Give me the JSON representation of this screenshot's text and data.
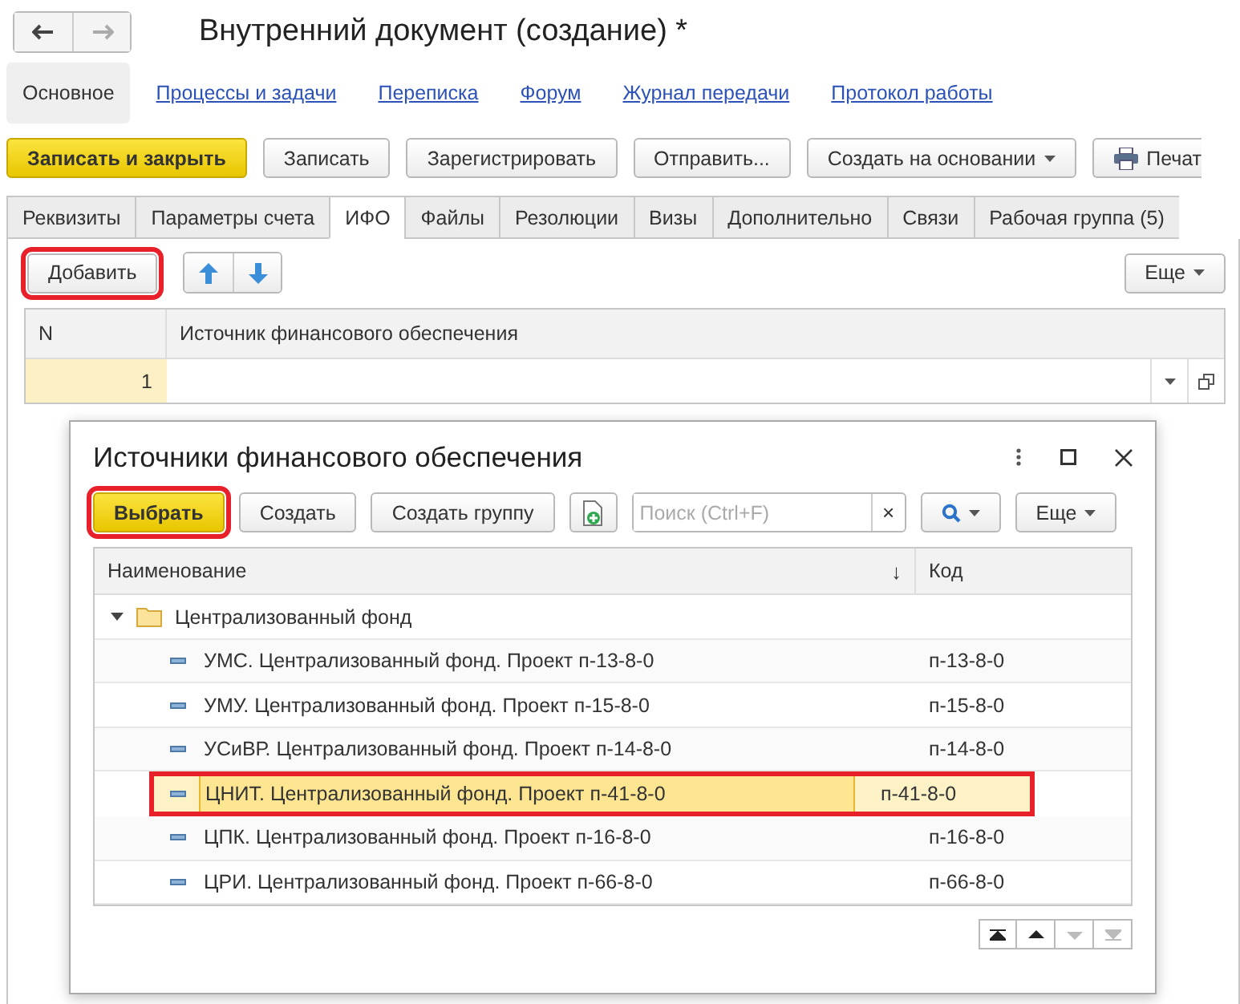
{
  "window": {
    "title": "Внутренний документ (создание) *"
  },
  "sections": [
    {
      "label": "Основное",
      "selected": true
    },
    {
      "label": "Процессы и задачи",
      "selected": false
    },
    {
      "label": "Переписка",
      "selected": false
    },
    {
      "label": "Форум",
      "selected": false
    },
    {
      "label": "Журнал передачи",
      "selected": false
    },
    {
      "label": "Протокол работы",
      "selected": false
    }
  ],
  "toolbar": [
    {
      "label": "Записать и закрыть",
      "kind": "primary"
    },
    {
      "label": "Записать",
      "kind": "plain"
    },
    {
      "label": "Зарегистрировать",
      "kind": "plain"
    },
    {
      "label": "Отправить...",
      "kind": "plain"
    },
    {
      "label": "Создать на основании",
      "kind": "menu"
    },
    {
      "label": "Печат",
      "kind": "print"
    }
  ],
  "tabs": [
    {
      "label": "Реквизиты",
      "selected": false
    },
    {
      "label": "Параметры счета",
      "selected": false
    },
    {
      "label": "ИФО",
      "selected": true
    },
    {
      "label": "Файлы",
      "selected": false
    },
    {
      "label": "Резолюции",
      "selected": false
    },
    {
      "label": "Визы",
      "selected": false
    },
    {
      "label": "Дополнительно",
      "selected": false
    },
    {
      "label": "Связи",
      "selected": false
    },
    {
      "label": "Рабочая группа (5)",
      "selected": false
    }
  ],
  "table_toolbar": {
    "add": {
      "label": "Добавить",
      "highlighted": true
    },
    "more": "Еще"
  },
  "table": {
    "columns": [
      "N",
      "Источник финансового обеспечения"
    ],
    "rows": [
      {
        "n": "1"
      }
    ]
  },
  "dialog": {
    "title": "Источники финансового обеспечения",
    "buttons": [
      {
        "label": "Выбрать",
        "kind": "primary",
        "highlighted": true
      },
      {
        "label": "Создать",
        "kind": "plain",
        "highlighted": false
      },
      {
        "label": "Создать группу",
        "kind": "plain",
        "highlighted": false
      }
    ],
    "search": {
      "placeholder": "Поиск (Ctrl+F)",
      "clear": "×"
    },
    "more": "Еще",
    "columns": [
      "Наименование",
      "Код"
    ],
    "sort_mark": "↓",
    "groups": [
      {
        "label": "Централизованный фонд",
        "expanded": true,
        "children": [
          {
            "name": "УМС. Централизованный фонд. Проект п-13-8-0",
            "code": "п-13-8-0",
            "selected": false,
            "highlighted": false
          },
          {
            "name": "УМУ. Централизованный фонд. Проект п-15-8-0",
            "code": "п-15-8-0",
            "selected": false,
            "highlighted": false
          },
          {
            "name": "УСиВР. Централизованный фонд. Проект п-14-8-0",
            "code": "п-14-8-0",
            "selected": false,
            "highlighted": false
          },
          {
            "name": "ЦНИТ. Централизованный фонд. Проект п-41-8-0",
            "code": "п-41-8-0",
            "selected": true,
            "highlighted": true
          },
          {
            "name": "ЦПК. Централизованный фонд. Проект п-16-8-0",
            "code": "п-16-8-0",
            "selected": false,
            "highlighted": false
          },
          {
            "name": "ЦРИ. Централизованный фонд. Проект п-66-8-0",
            "code": "п-66-8-0",
            "selected": false,
            "highlighted": false
          }
        ]
      }
    ],
    "scroll_buttons": [
      {
        "kind": "first",
        "disabled": false
      },
      {
        "kind": "up",
        "disabled": false
      },
      {
        "kind": "down",
        "disabled": true
      },
      {
        "kind": "last",
        "disabled": true
      }
    ]
  }
}
